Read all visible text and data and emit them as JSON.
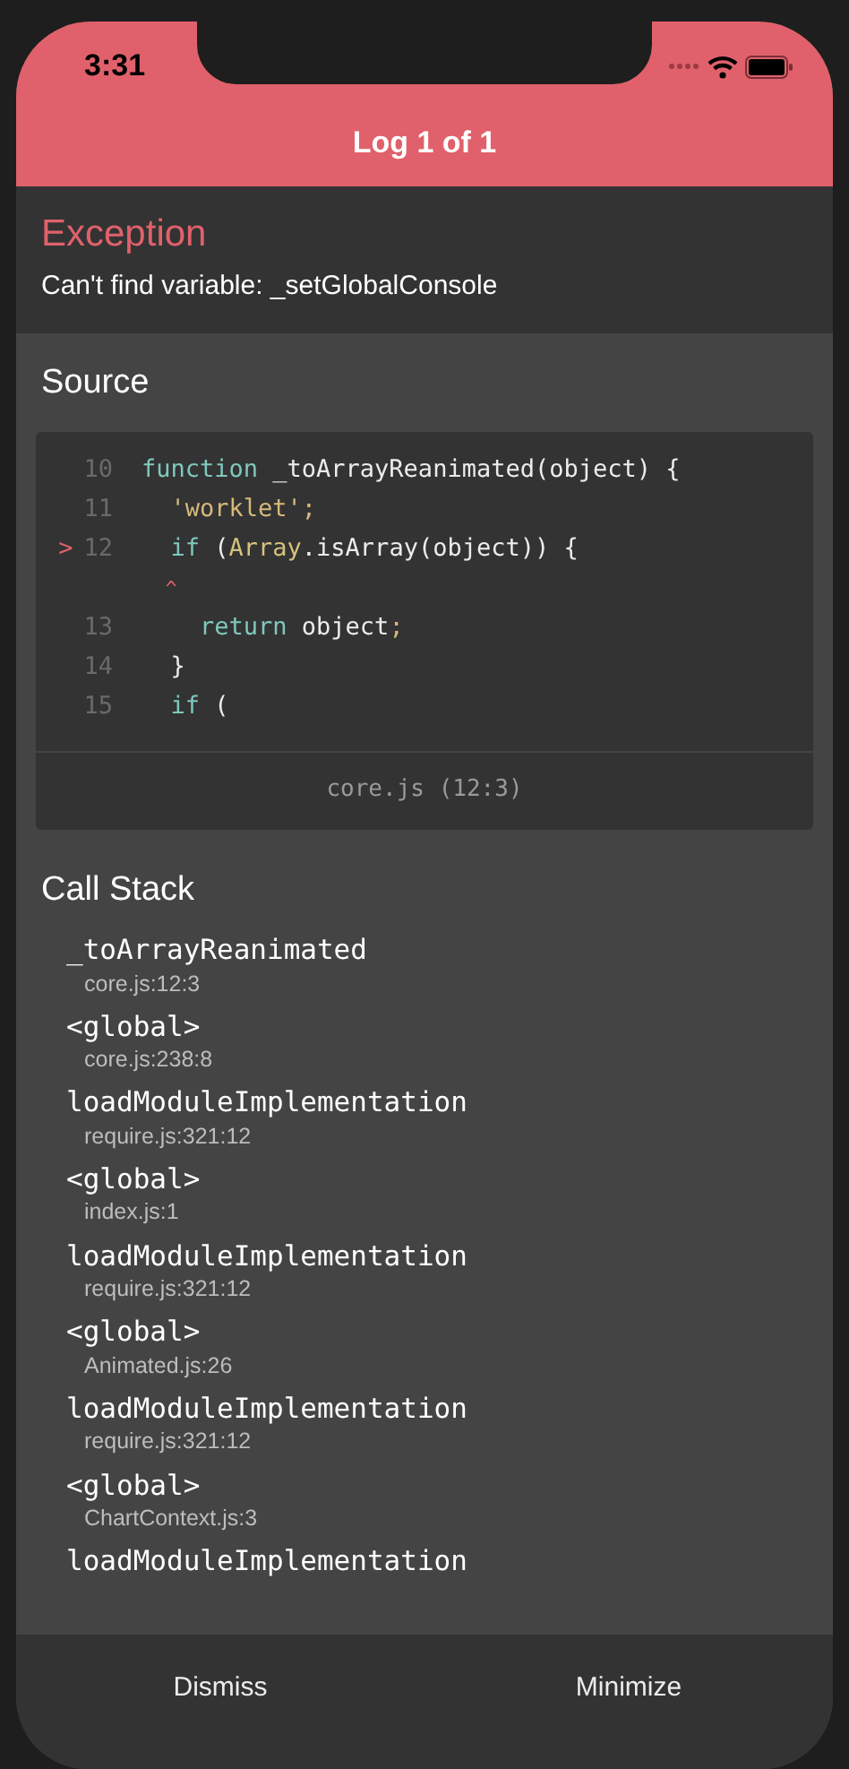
{
  "status_bar": {
    "time": "3:31"
  },
  "header": {
    "title": "Log 1 of 1"
  },
  "exception": {
    "heading": "Exception",
    "message": "Can't find variable: _setGlobalConsole"
  },
  "source": {
    "heading": "Source",
    "lines": [
      {
        "kind": "code",
        "number": "10",
        "tokens": [
          {
            "kind": "keyword",
            "text": "function"
          },
          {
            "kind": "plain",
            "text": " _toArrayReanimated(object) {"
          }
        ]
      },
      {
        "kind": "code",
        "number": "11",
        "tokens": [
          {
            "kind": "string",
            "text": "  'worklet'"
          },
          {
            "kind": "string",
            "text": ";"
          }
        ]
      },
      {
        "kind": "code",
        "number": "12",
        "marker": ">",
        "tokens": [
          {
            "kind": "keyword",
            "text": "  if"
          },
          {
            "kind": "plain",
            "text": " ("
          },
          {
            "kind": "builtin",
            "text": "Array"
          },
          {
            "kind": "plain",
            "text": ".isArray(object)) {"
          }
        ]
      },
      {
        "kind": "caret",
        "tokens": [
          {
            "kind": "error",
            "text": "  ^"
          }
        ]
      },
      {
        "kind": "code",
        "number": "13",
        "tokens": [
          {
            "kind": "keyword",
            "text": "    return"
          },
          {
            "kind": "plain",
            "text": " object"
          },
          {
            "kind": "string",
            "text": ";"
          }
        ]
      },
      {
        "kind": "code",
        "number": "14",
        "tokens": [
          {
            "kind": "plain",
            "text": "  }"
          }
        ]
      },
      {
        "kind": "code",
        "number": "15",
        "tokens": [
          {
            "kind": "keyword",
            "text": "  if"
          },
          {
            "kind": "plain",
            "text": " ("
          }
        ]
      }
    ],
    "location": "core.js (12:3)"
  },
  "call_stack": {
    "heading": "Call Stack",
    "frames": [
      {
        "method": "_toArrayReanimated",
        "file": "core.js:12:3"
      },
      {
        "method": "<global>",
        "file": "core.js:238:8"
      },
      {
        "method": "loadModuleImplementation",
        "file": "require.js:321:12"
      },
      {
        "method": "<global>",
        "file": "index.js:1"
      },
      {
        "method": "loadModuleImplementation",
        "file": "require.js:321:12"
      },
      {
        "method": "<global>",
        "file": "Animated.js:26"
      },
      {
        "method": "loadModuleImplementation",
        "file": "require.js:321:12"
      },
      {
        "method": "<global>",
        "file": "ChartContext.js:3"
      },
      {
        "method": "loadModuleImplementation"
      }
    ]
  },
  "footer": {
    "buttons": [
      "Dismiss",
      "Minimize"
    ]
  }
}
